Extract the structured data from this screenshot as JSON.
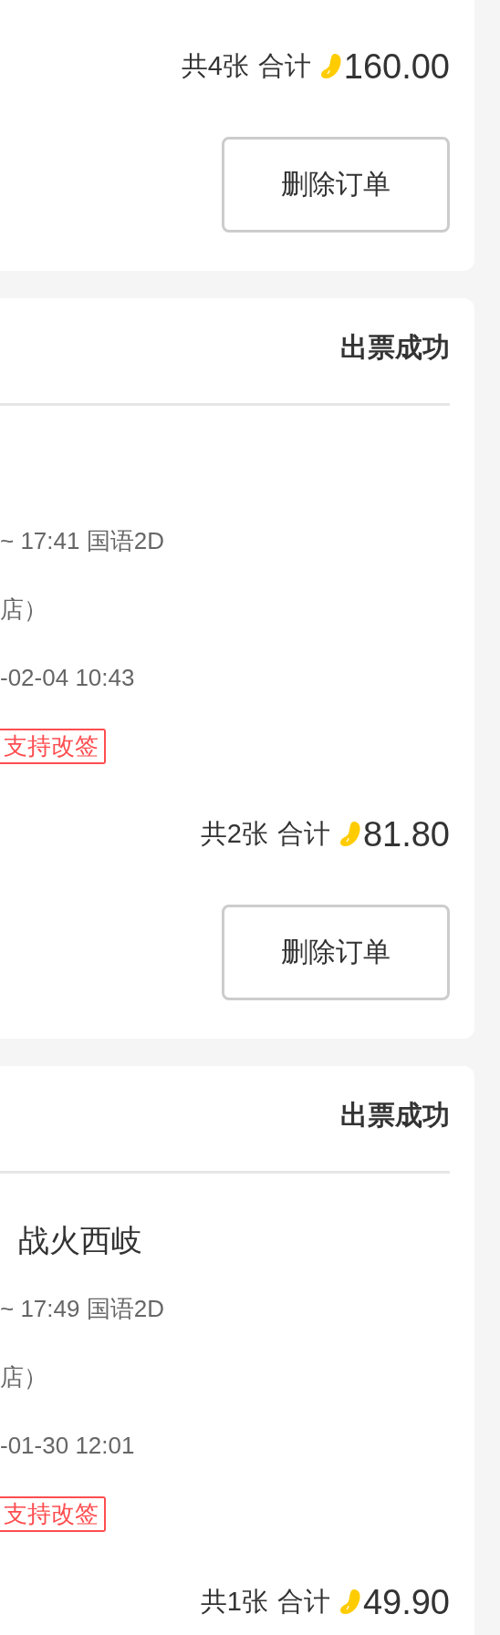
{
  "orders": [
    {
      "total": {
        "count": "共4张",
        "label": "合计",
        "amount": "160.00"
      },
      "actions": [
        "删除订单"
      ]
    },
    {
      "status": "出票成功",
      "showtime": "~ 17:41 国语2D",
      "cinema": "店）",
      "order_time": "-02-04 10:43",
      "tag": "支持改签",
      "total": {
        "count": "共2张",
        "label": "合计",
        "amount": "81.80"
      },
      "actions": [
        "删除订单"
      ]
    },
    {
      "status": "出票成功",
      "title": "战火西岐",
      "showtime": "~ 17:49 国语2D",
      "cinema": "店）",
      "order_time": "-01-30 12:01",
      "tag": "支持改签",
      "total": {
        "count": "共1张",
        "label": "合计",
        "amount": "49.90"
      }
    }
  ]
}
